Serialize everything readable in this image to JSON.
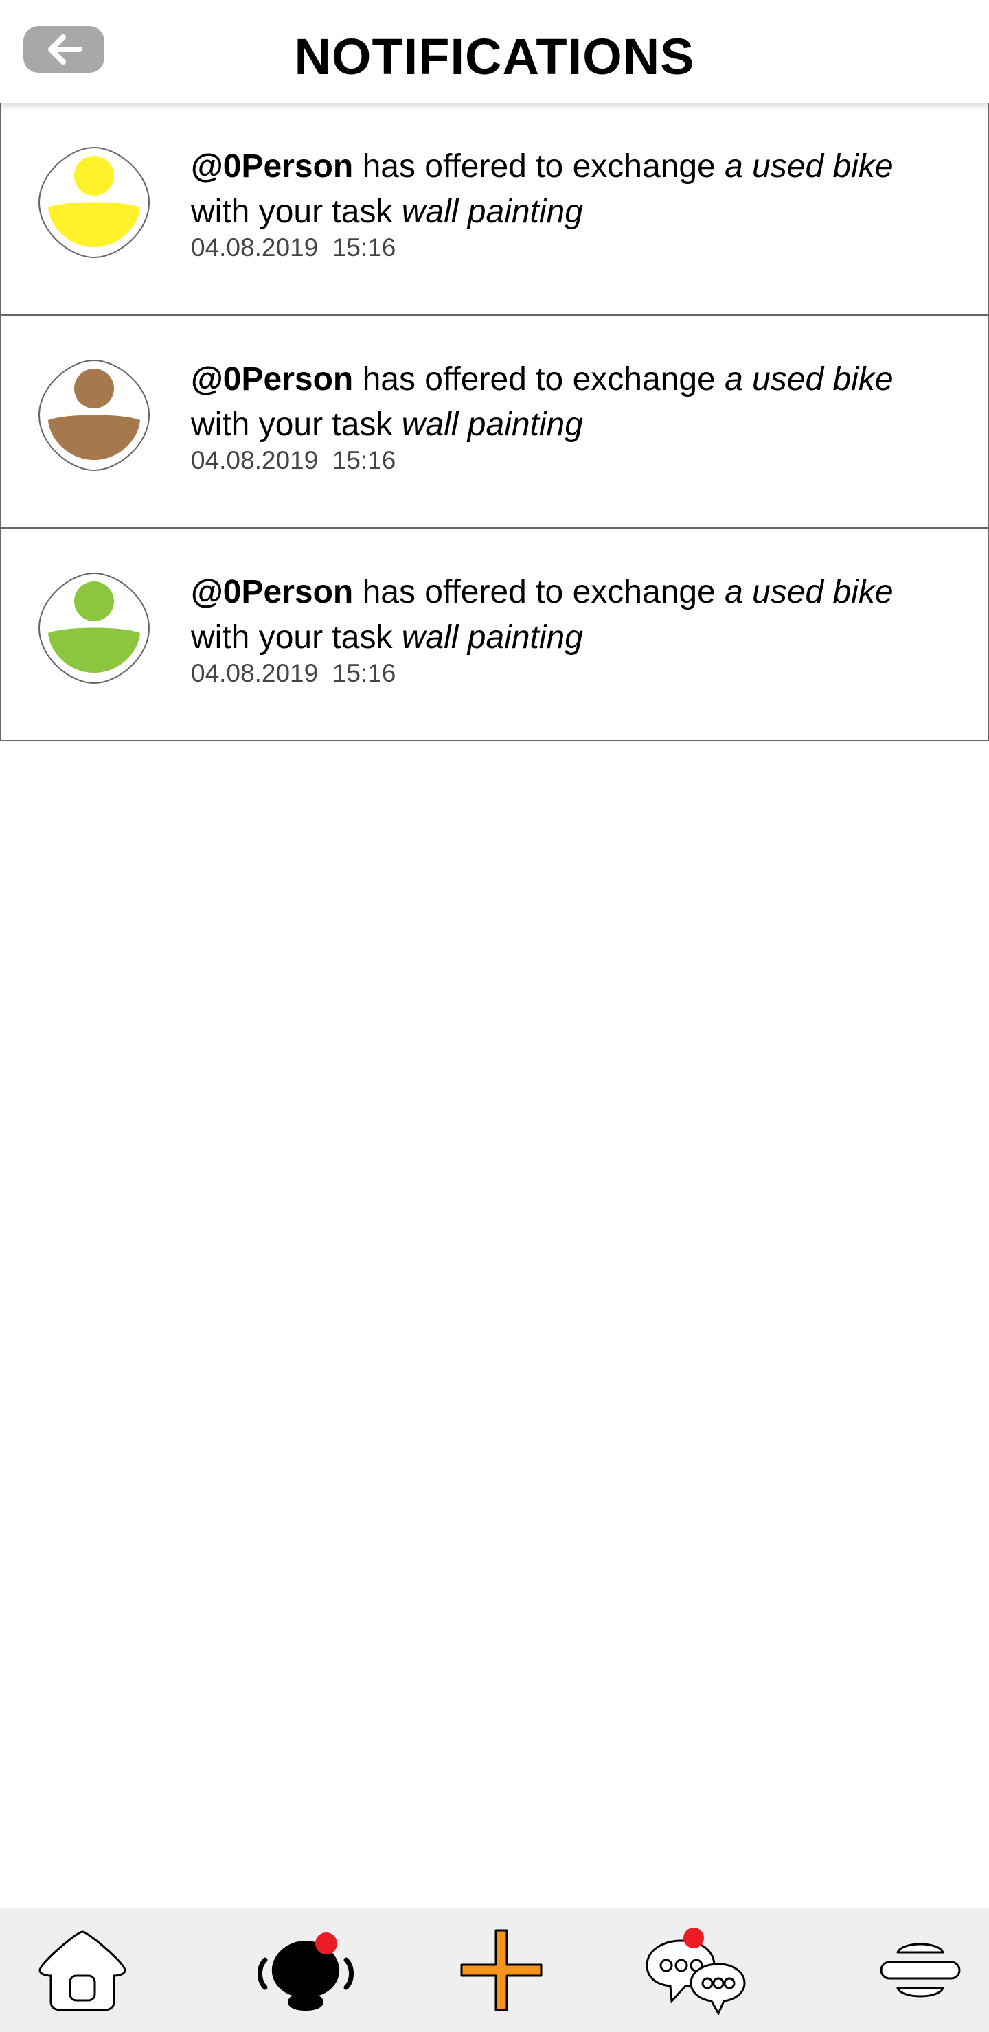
{
  "header": {
    "title": "NOTIFICATIONS",
    "back_icon": "arrow-left-icon"
  },
  "notifications": [
    {
      "user": "@0Person",
      "text_1": " has offered to exchange ",
      "item": "a used bike",
      "text_2": "with your task ",
      "task": "wall painting",
      "date": "04.08.2019",
      "time": "15:16",
      "avatar_color": "#fff22b"
    },
    {
      "user": "@0Person",
      "text_1": " has offered to exchange ",
      "item": "a used bike",
      "text_2": "with your task ",
      "task": "wall painting",
      "date": "04.08.2019",
      "time": "15:16",
      "avatar_color": "#a6784e"
    },
    {
      "user": "@0Person",
      "text_1": " has offered to exchange ",
      "item": "a used bike",
      "text_2": "with your task ",
      "task": "wall painting",
      "date": "04.08.2019",
      "time": "15:16",
      "avatar_color": "#8cc63f"
    }
  ],
  "bottom_nav": {
    "items": [
      {
        "icon": "home-icon"
      },
      {
        "icon": "notifications-icon",
        "badge": true
      },
      {
        "icon": "add-icon",
        "color": "#f7941d"
      },
      {
        "icon": "chat-icon",
        "badge": true
      },
      {
        "icon": "menu-icon"
      }
    ],
    "badge_color": "#ed1c24"
  }
}
